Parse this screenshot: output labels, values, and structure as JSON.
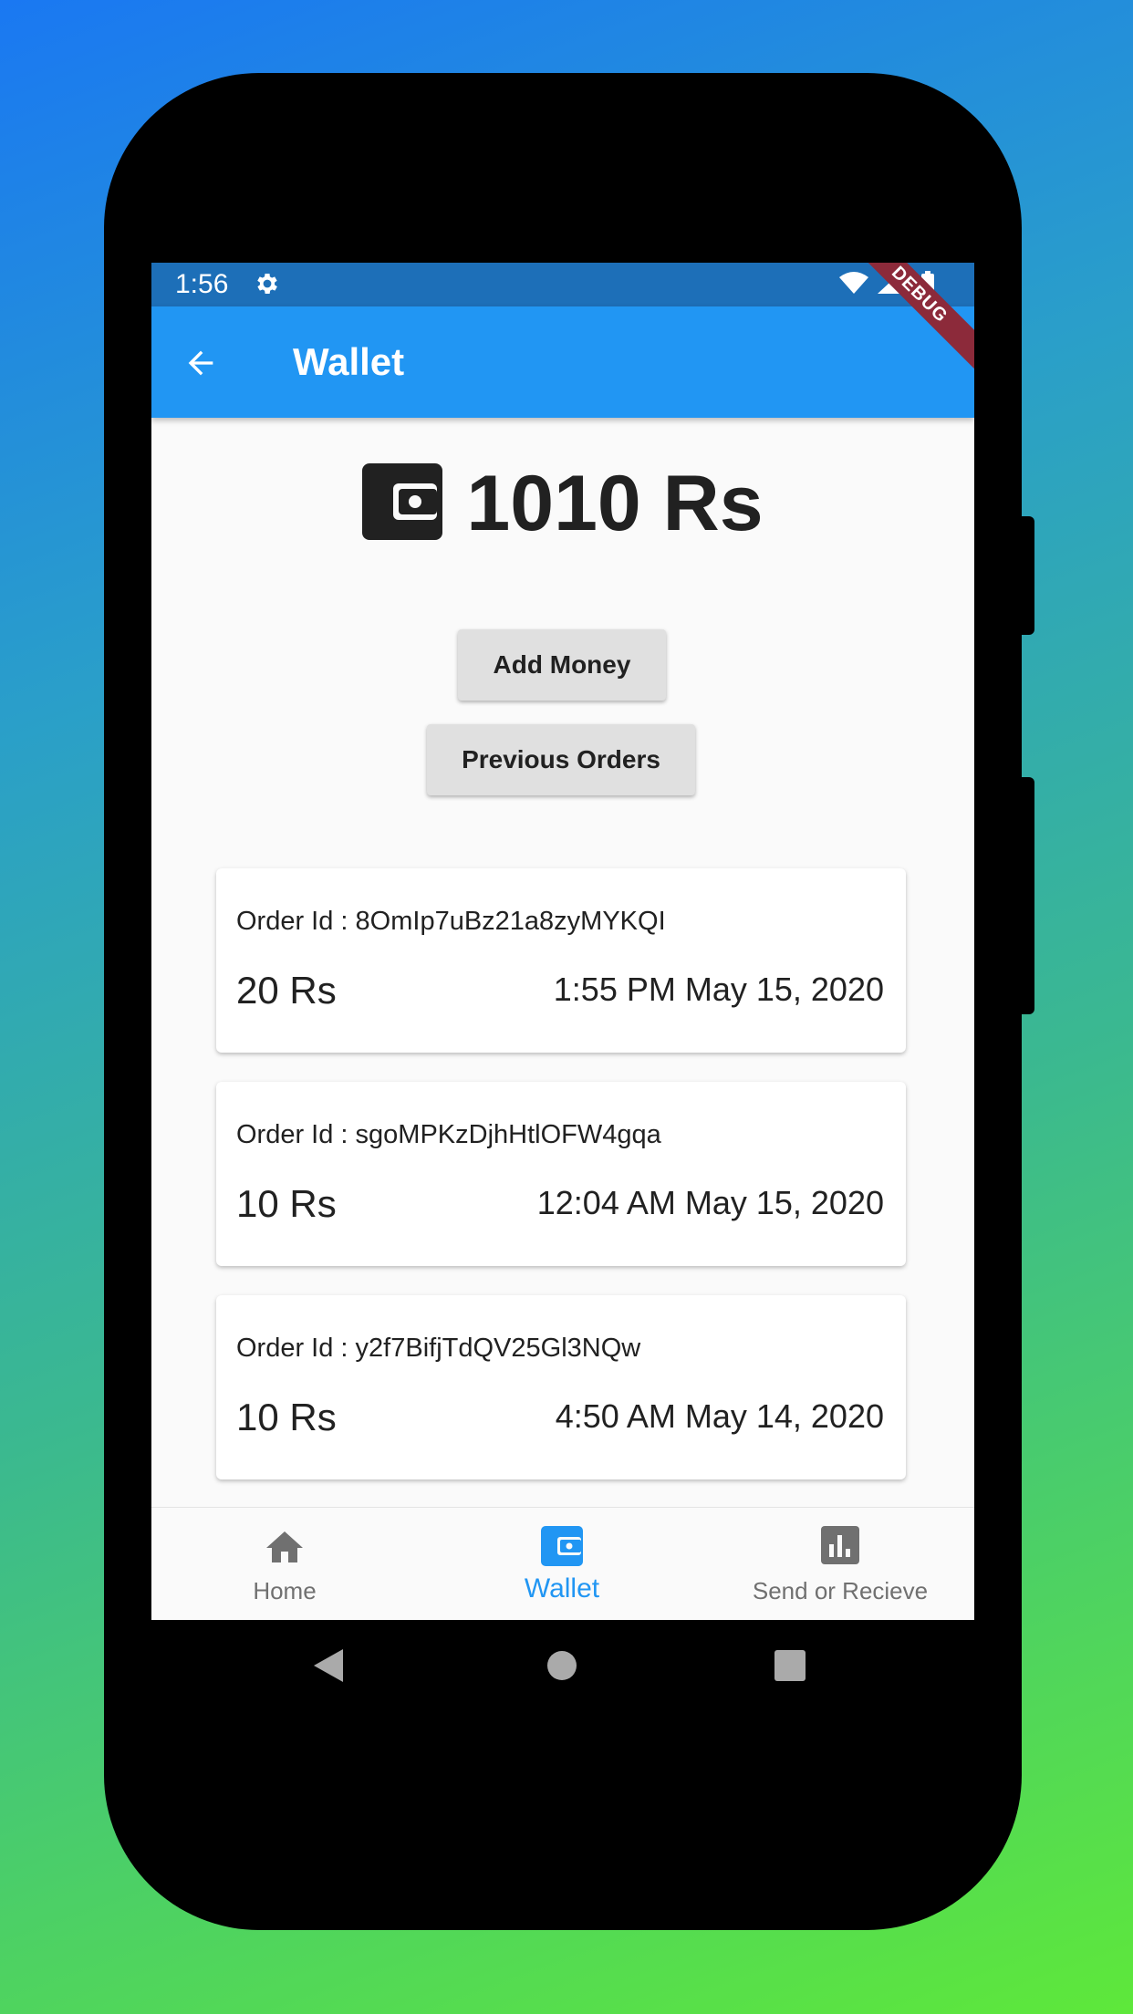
{
  "status": {
    "time": "1:56"
  },
  "appbar": {
    "title": "Wallet",
    "debug_label": "DEBUG"
  },
  "balance": {
    "amount": "1010 Rs"
  },
  "buttons": {
    "add_money": "Add Money",
    "previous_orders": "Previous Orders"
  },
  "orders": [
    {
      "order_id": "Order Id : 8OmIp7uBz21a8zyMYKQI",
      "amount": "20 Rs",
      "datetime": "1:55 PM May 15, 2020"
    },
    {
      "order_id": "Order Id : sgoMPKzDjhHtlOFW4gqa",
      "amount": "10 Rs",
      "datetime": "12:04 AM May 15, 2020"
    },
    {
      "order_id": "Order Id : y2f7BifjTdQV25Gl3NQw",
      "amount": "10 Rs",
      "datetime": "4:50 AM May 14, 2020"
    }
  ],
  "bottom_nav": {
    "items": [
      {
        "label": "Home",
        "icon": "home-icon"
      },
      {
        "label": "Wallet",
        "icon": "wallet-icon",
        "active": true
      },
      {
        "label": "Send or Recieve",
        "icon": "chart-icon"
      }
    ]
  },
  "colors": {
    "primary": "#2196f3",
    "status_bar": "#1d6fb8",
    "active_nav": "#2196f3",
    "inactive_nav": "#707070"
  }
}
